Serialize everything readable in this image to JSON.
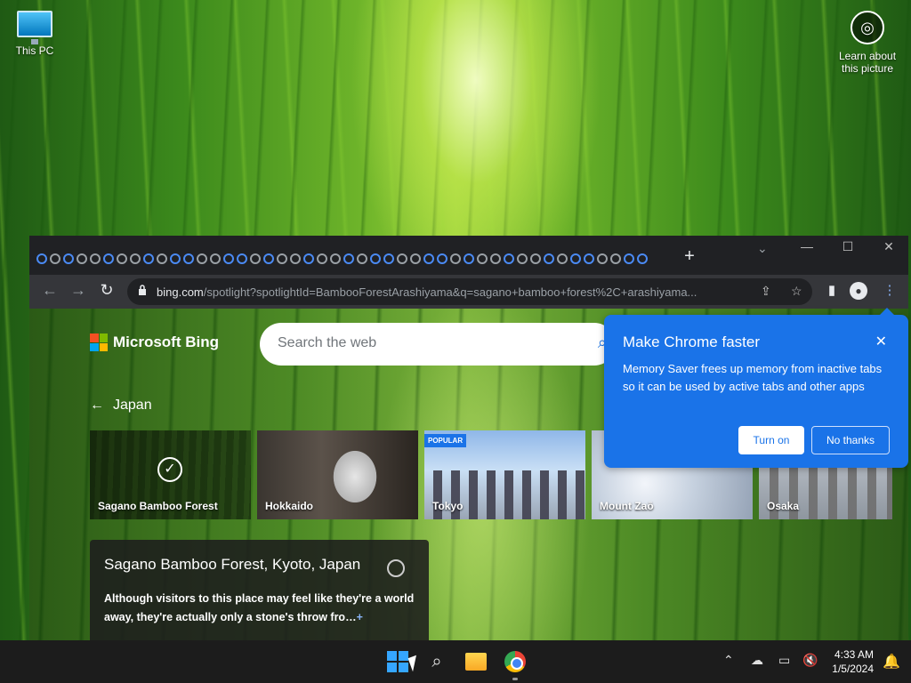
{
  "desktop": {
    "this_pc_label": "This PC",
    "learn_label_line1": "Learn about",
    "learn_label_line2": "this picture"
  },
  "browser": {
    "new_tab": "+",
    "window_controls": {
      "minimize": "—",
      "maximize": "☐",
      "close": "✕"
    },
    "url_host": "bing.com",
    "url_path": "/spotlight?spotlightId=BambooForestArashiyama&q=sagano+bamboo+forest%2C+arashiyama..."
  },
  "bing": {
    "logo_text": "Microsoft Bing",
    "search_placeholder": "Search the web",
    "back_label": "Japan",
    "cards": [
      {
        "label": "Sagano Bamboo Forest",
        "selected": true
      },
      {
        "label": "Hokkaido"
      },
      {
        "label": "Tokyo",
        "badge": "POPULAR"
      },
      {
        "label": "Mount Zaō"
      },
      {
        "label": "Osaka"
      }
    ],
    "info_title": "Sagano Bamboo Forest, Kyoto, Japan",
    "info_body": "Although visitors to this place may feel like they're a world away, they're actually only a stone's throw fro…",
    "info_more": "+"
  },
  "popup": {
    "title": "Make Chrome faster",
    "close": "✕",
    "body": "Memory Saver frees up memory from inactive tabs so it can be used by active tabs and other apps",
    "turn_on": "Turn on",
    "no_thanks": "No thanks"
  },
  "taskbar": {
    "time": "4:33 AM",
    "date": "1/5/2024"
  },
  "colors": {
    "popup_bg": "#1a73e8",
    "chrome_dark": "#202124",
    "taskbar": "#1c1c1c"
  }
}
